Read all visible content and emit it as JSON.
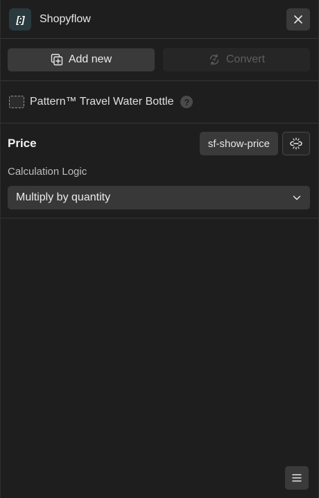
{
  "header": {
    "logo_text": "[:]",
    "title": "Shopyflow"
  },
  "toolbar": {
    "add_label": "Add new",
    "convert_label": "Convert"
  },
  "element": {
    "name": "Pattern™ Travel Water Bottle",
    "help_glyph": "?"
  },
  "price_section": {
    "title": "Price",
    "attribute": "sf-show-price",
    "field_label": "Calculation Logic",
    "select_value": "Multiply by quantity"
  },
  "icons": {
    "close": "close-icon",
    "add": "add-copy-icon",
    "convert": "convert-icon",
    "element": "dashed-box-icon",
    "help": "help-icon",
    "link": "unlink-icon",
    "chevron": "chevron-down-icon",
    "menu": "menu-icon"
  },
  "colors": {
    "background": "#1e1e1e",
    "button": "#3a3a3a",
    "divider": "#363636",
    "logo_bg": "#2a3a3e"
  }
}
